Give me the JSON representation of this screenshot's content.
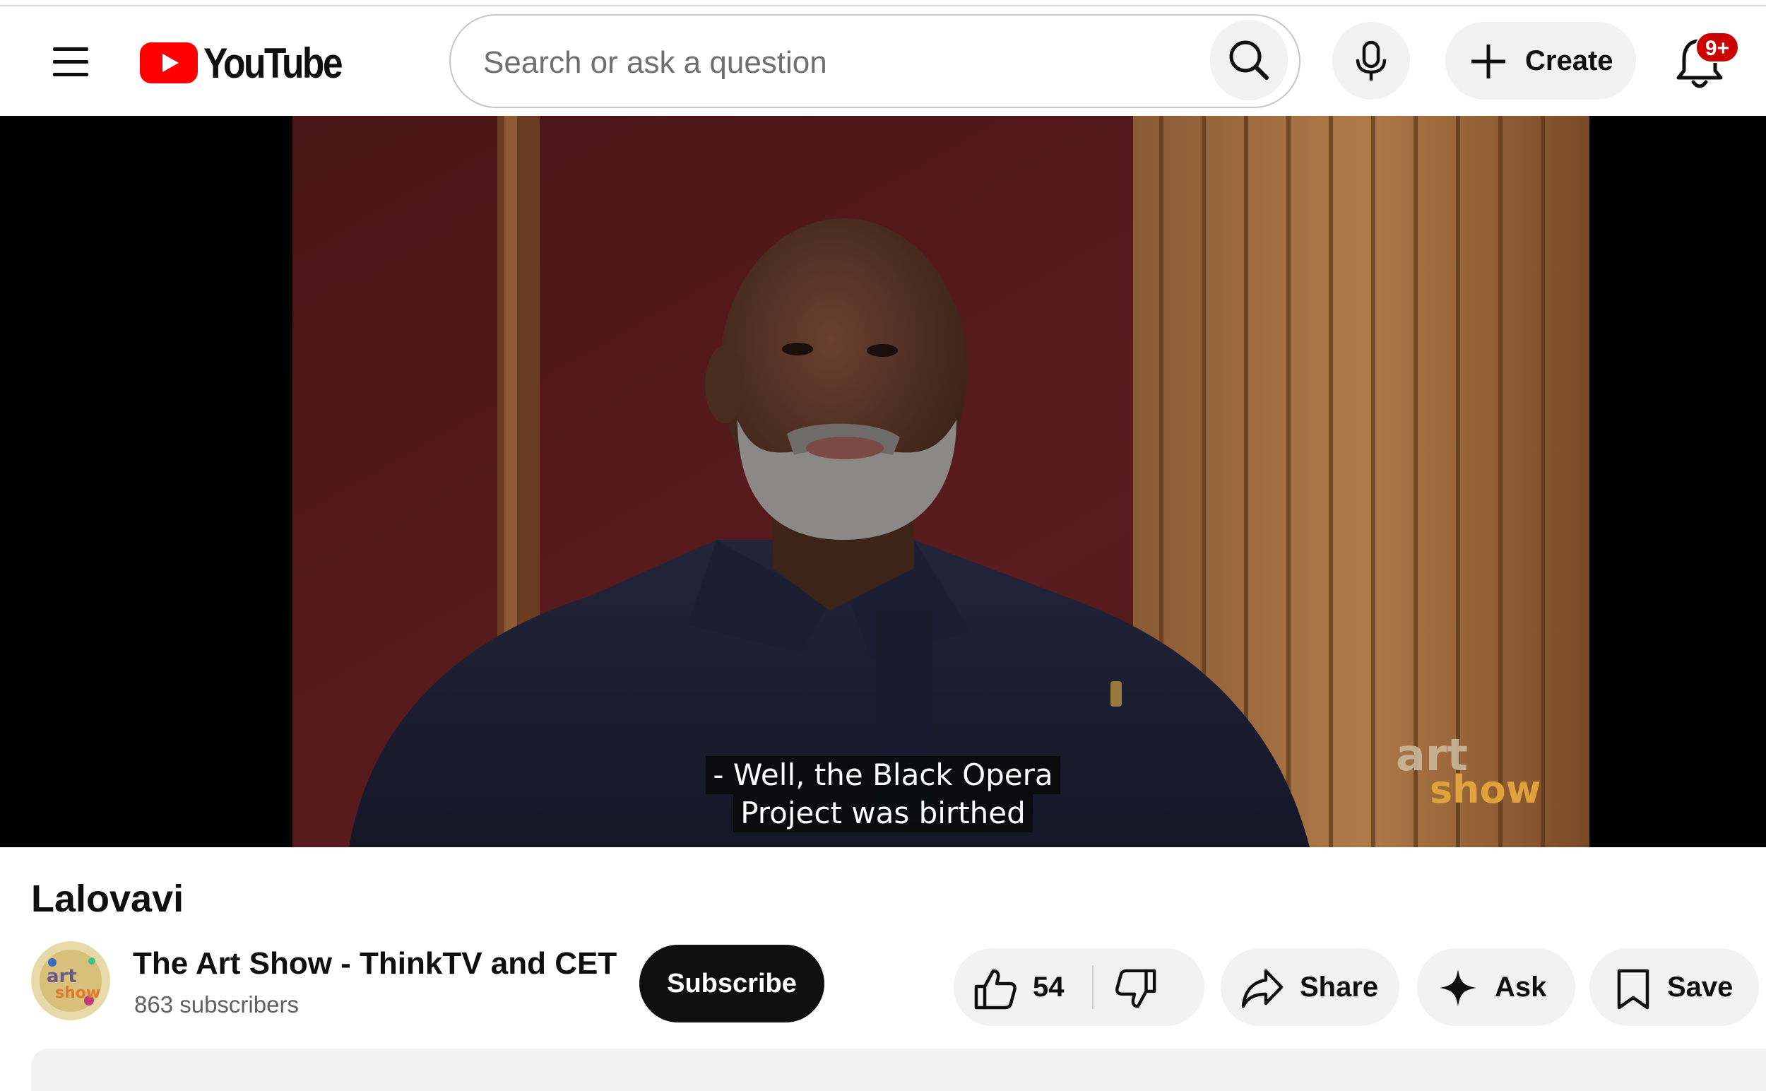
{
  "header": {
    "logo_text": "YouTube",
    "search_placeholder": "Search or ask a question",
    "create_label": "Create",
    "notification_badge": "9+"
  },
  "player": {
    "subtitle_lines": [
      "- Well, the Black Opera",
      "Project was birthed"
    ]
  },
  "video": {
    "title": "Lalovavi"
  },
  "channel": {
    "name": "The Art Show - ThinkTV and CET",
    "subscribers": "863 subscribers",
    "subscribe_label": "Subscribe"
  },
  "actions": {
    "like_count": "54",
    "share_label": "Share",
    "ask_label": "Ask",
    "save_label": "Save"
  },
  "colors": {
    "brand_red": "#ff0000",
    "badge_red": "#cc0000",
    "button_gray": "#f2f2f2",
    "subscribe_black": "#0f0f0f"
  }
}
